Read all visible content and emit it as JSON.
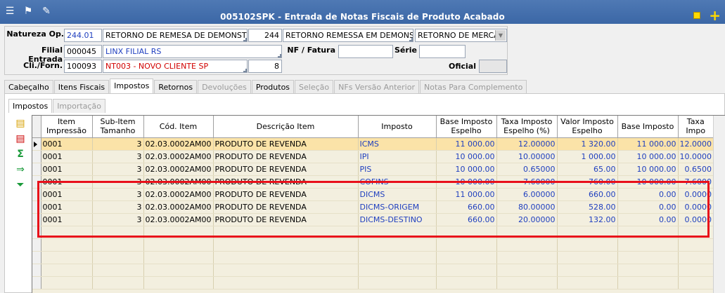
{
  "window": {
    "title": "005102SPK - Entrada de Notas Fiscais de Produto Acabado"
  },
  "header": {
    "natureza_label": "Natureza Op.",
    "natureza_code": "244.01",
    "natureza_desc": "RETORNO DE REMESA DE DEMONSTRACÃ",
    "natureza_num": "244",
    "natureza_desc2": "RETORNO REMESSA EM DEMONSTRAÇ",
    "natureza_select": "RETORNO DE MERCAI",
    "filial_label": "Filial Entrada",
    "filial_code": "000045",
    "filial_name": "LINX FILIAL RS",
    "nf_label": "NF / Fatura",
    "nf_value": "",
    "serie_label": "Série",
    "serie_value": "",
    "cli_label": "Cli./Forn.",
    "cli_code": "100093",
    "cli_name": "NT003 - NOVO CLIENTE SP",
    "cli_num": "8",
    "oficial_label": "Oficial",
    "oficial_value": ""
  },
  "tabs": [
    "Cabeçalho",
    "Itens Fiscais",
    "Impostos",
    "Retornos",
    "Devoluções",
    "Produtos",
    "Seleção",
    "NFs Versão Anterior",
    "Notas Para Complemento"
  ],
  "subtabs": [
    "Impostos",
    "Importação"
  ],
  "table": {
    "columns": [
      "Item Impressão",
      "Sub-Item Tamanho",
      "Cód. Item",
      "Descrição Item",
      "Imposto",
      "Base Imposto Espelho",
      "Taxa Imposto Espelho (%)",
      "Valor Imposto Espelho",
      "Base Imposto",
      "Taxa Impo"
    ],
    "rows": [
      [
        "0001",
        "3",
        "02.03.0002AM00",
        "PRODUTO DE REVENDA",
        "ICMS",
        "11 000.00",
        "12.00000",
        "1 320.00",
        "11 000.00",
        "12.0000"
      ],
      [
        "0001",
        "3",
        "02.03.0002AM00",
        "PRODUTO DE REVENDA",
        "IPI",
        "10 000.00",
        "10.00000",
        "1 000.00",
        "10 000.00",
        "10.0000"
      ],
      [
        "0001",
        "3",
        "02.03.0002AM00",
        "PRODUTO DE REVENDA",
        "PIS",
        "10 000.00",
        "0.65000",
        "65.00",
        "10 000.00",
        "0.6500"
      ],
      [
        "0001",
        "3",
        "02.03.0002AM00",
        "PRODUTO DE REVENDA",
        "COFINS",
        "10 000.00",
        "7.60000",
        "760.00",
        "10 000.00",
        "7.6000"
      ],
      [
        "0001",
        "3",
        "02.03.0002AM00",
        "PRODUTO DE REVENDA",
        "DICMS",
        "11 000.00",
        "6.00000",
        "660.00",
        "0.00",
        "0.0000"
      ],
      [
        "0001",
        "3",
        "02.03.0002AM00",
        "PRODUTO DE REVENDA",
        "DICMS-ORIGEM",
        "660.00",
        "80.00000",
        "528.00",
        "0.00",
        "0.0000"
      ],
      [
        "0001",
        "3",
        "02.03.0002AM00",
        "PRODUTO DE REVENDA",
        "DICMS-DESTINO",
        "660.00",
        "20.00000",
        "132.00",
        "0.00",
        "0.0000"
      ]
    ]
  }
}
